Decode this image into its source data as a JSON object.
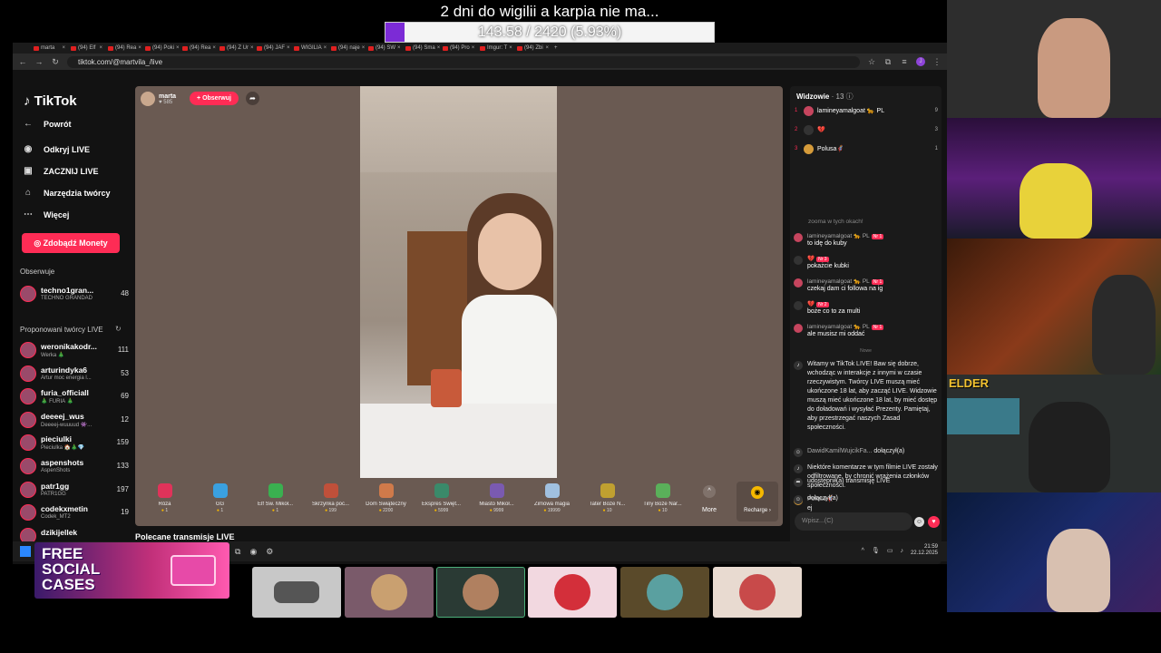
{
  "overlay": {
    "goal_title": "2 dni do wigilii a karpia nie ma...",
    "goal_progress_text": "143.58 / 2420 (5.93%)",
    "goal_fraction": 0.0593,
    "goal_color": "#7c2bd6"
  },
  "browser": {
    "tabs": [
      "marta",
      "(94) Elf",
      "(94) Rea",
      "(94) Poki",
      "(94) Rea",
      "(94) Z Ur",
      "(94) JAF",
      "WIGILIA",
      "(94) naje",
      "(94) SW",
      "(94) Sma",
      "(94) Pro",
      "Imgur: T",
      "(94) Zbi"
    ],
    "url": "tiktok.com/@martvila_/live",
    "profile_initial": "J"
  },
  "tiktok": {
    "logo": "TikTok",
    "nav": [
      {
        "label": "Powrót",
        "icon": "back-arrow-icon"
      },
      {
        "label": "Odkryj LIVE",
        "icon": "live-icon"
      },
      {
        "label": "ZACZNIJ LIVE",
        "icon": "camera-icon"
      },
      {
        "label": "Narzędzia twórcy",
        "icon": "home-icon"
      },
      {
        "label": "Więcej",
        "icon": "more-icon"
      }
    ],
    "coins_button": "Zdobądź Monety",
    "following_header": "Obserwuje",
    "following": [
      {
        "name": "techno1gran...",
        "sub": "TECHNO GRANDAD",
        "count": "48"
      }
    ],
    "suggested_header": "Proponowani twórcy LIVE",
    "suggested_creators": [
      {
        "name": "weronikakodr...",
        "sub": "Werka 🎄",
        "count": "111"
      },
      {
        "name": "arturindyka6",
        "sub": "Artur moc energia l...",
        "count": "53"
      },
      {
        "name": "furia_officiall",
        "sub": "🎄 FURIA 🎄",
        "count": "69"
      },
      {
        "name": "deeeej_wus",
        "sub": "Deeeej-wuuuud 👾...",
        "count": "12"
      },
      {
        "name": "pieciulki",
        "sub": "Pieciulka 🏠🎄💎",
        "count": "159"
      },
      {
        "name": "aspenshots",
        "sub": "AspenShots",
        "count": "133"
      },
      {
        "name": "patr1gg",
        "sub": "PATR1GG",
        "count": "197"
      },
      {
        "name": "codekxmetin",
        "sub": "Codek_MT2",
        "count": "19"
      },
      {
        "name": "dzikijellek",
        "sub": "",
        "count": ""
      }
    ],
    "streamer": {
      "name": "marta",
      "likes": "♥ 585"
    },
    "follow_button": "+ Obserwuj",
    "gifts": [
      {
        "name": "Róża",
        "price": "1",
        "color": "#e0335a"
      },
      {
        "name": "GG",
        "price": "1",
        "color": "#3aa0e0"
      },
      {
        "name": "Elf Św. Mikoł...",
        "price": "1",
        "color": "#3ab050"
      },
      {
        "name": "Skrzynka poc...",
        "price": "199",
        "color": "#c0503a"
      },
      {
        "name": "Dom Świąteczny",
        "price": "2200",
        "color": "#d07a4a"
      },
      {
        "name": "Ekspres Święt...",
        "price": "5999",
        "color": "#3a8a6a"
      },
      {
        "name": "Miasto Mikoł...",
        "price": "9999",
        "color": "#7a5ab0"
      },
      {
        "name": "Zimowa magia",
        "price": "19999",
        "color": "#a0c0e0"
      },
      {
        "name": "Tater Boże N...",
        "price": "10",
        "color": "#c0a030"
      },
      {
        "name": "Tiny Boże Nar...",
        "price": "10",
        "color": "#5ab05a"
      }
    ],
    "more_label": "More",
    "recharge_label": "Recharge ›",
    "suggested_live_label": "Polecane transmisje LIVE",
    "viewers_label": "Widzowie",
    "viewers_count": "· 13",
    "top_viewers": [
      {
        "rank": "1",
        "name": "lamineyamalgoat 🐆 PL",
        "score": "9"
      },
      {
        "rank": "2",
        "name": "💔",
        "score": "3"
      },
      {
        "rank": "3",
        "name": "Polusa🦸",
        "score": "1"
      }
    ],
    "faded_message": "zooma w tych okach!",
    "chat": [
      {
        "user": "lamineyamalgoat 🐆 PL",
        "badge": "Nr 1",
        "text": "to idę do kuby"
      },
      {
        "user": "💔",
        "badge": "Nr 3",
        "text": "pokażcie kubki"
      },
      {
        "user": "lamineyamalgoat 🐆 PL",
        "badge": "Nr 1",
        "text": "czekaj dam ci followa na ig"
      },
      {
        "user": "💔",
        "badge": "Nr 2",
        "text": "boże co to za multi"
      },
      {
        "user": "lamineyamalgoat 🐆 PL",
        "badge": "Nr 1",
        "text": "ale musisz mi oddać"
      }
    ],
    "divider_label": "Nowe",
    "system_welcome": "Witamy w TikTok LIVE! Baw się dobrze, wchodząc w interakcje z innymi w czasie rzeczywistym. Twórcy LIVE muszą mieć ukończone 18 lat, aby zacząć LIVE. Widzowie muszą mieć ukończone 18 lat, by mieć dostęp do doładowań i wysyłać Prezenty. Pamiętaj, aby przestrzegać naszych Zasad społeczności.",
    "joined_user": "DawidKamilWujcikFa...",
    "joined_text": "dołączył(a)",
    "filter_notice": "Niektóre komentarze w tym filmie LIVE zostały odfiltrowane, by chronić wrażenia członków społeczności.",
    "polusa_name": "Polusa🦸",
    "polusa_text": "ej",
    "shared_text": "udostępnił(a) transmisję LIVE",
    "joined_text2": "dołączył(a)",
    "chat_placeholder": "Wpisz...(C)"
  },
  "taskbar": {
    "time": "21:59",
    "date": "22.12.2025"
  },
  "promo": {
    "line1": "FREE",
    "line2": "SOCIAL",
    "line3": "CASES"
  },
  "webcam_label": "ELDER"
}
